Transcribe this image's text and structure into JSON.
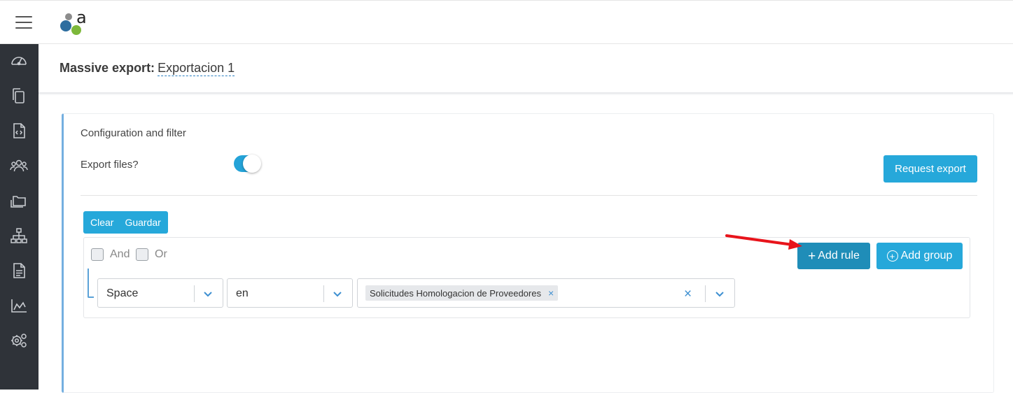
{
  "header": {
    "menu_icon": "hamburger-icon",
    "logo": "app-logo"
  },
  "sidebar": {
    "items": [
      {
        "icon": "dashboard-gauge-icon"
      },
      {
        "icon": "documents-copy-icon"
      },
      {
        "icon": "code-file-icon"
      },
      {
        "icon": "users-group-icon"
      },
      {
        "icon": "folders-icon"
      },
      {
        "icon": "org-chart-icon"
      },
      {
        "icon": "report-file-icon"
      },
      {
        "icon": "area-chart-icon"
      },
      {
        "icon": "settings-gears-icon"
      }
    ],
    "background": "#2f3339"
  },
  "page": {
    "title_label": "Massive export:",
    "title_value": "Exportacion 1"
  },
  "panel": {
    "title": "Configuration and filter",
    "export_files_label": "Export files?",
    "export_files_enabled": true,
    "request_export_label": "Request export"
  },
  "query_builder": {
    "clear_label": "Clear",
    "save_label": "Guardar",
    "conditions": [
      {
        "label": "And",
        "checked": false
      },
      {
        "label": "Or",
        "checked": false
      }
    ],
    "add_rule_label": "Add rule",
    "add_group_label": "Add group",
    "rule": {
      "field": "Space",
      "operator": "en",
      "values": [
        "Solicitudes Homologacion de Proveedores"
      ]
    }
  },
  "colors": {
    "accent": "#26a8da",
    "accent_dark": "#1f8db8",
    "annotation_arrow": "#e8141b"
  }
}
